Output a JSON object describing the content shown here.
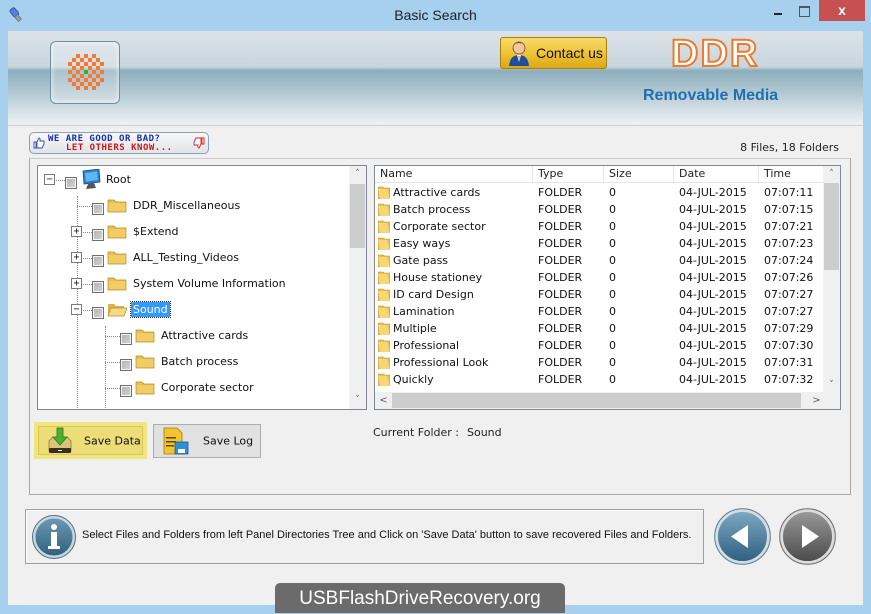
{
  "window": {
    "title": "Basic Search",
    "close_glyph": "x",
    "app_icon": "usb-drive-icon"
  },
  "banner": {
    "contact_label": "Contact us",
    "brand": "DDR",
    "subtitle": "Removable Media",
    "brand_color": "#f07a2a",
    "subtitle_color": "#1f6fb2"
  },
  "feedback": {
    "line1": "WE ARE GOOD OR BAD?",
    "line2": "LET OTHERS KNOW..."
  },
  "summary": {
    "counts": "8 Files, 18 Folders"
  },
  "tree": {
    "nodes": [
      {
        "label": "Root",
        "icon": "computer-icon",
        "expander": "−",
        "level": 0
      },
      {
        "label": "DDR_Miscellaneous",
        "icon": "folder-icon",
        "expander": "",
        "level": 1
      },
      {
        "label": "$Extend",
        "icon": "folder-icon",
        "expander": "+",
        "level": 1
      },
      {
        "label": "ALL_Testing_Videos",
        "icon": "folder-icon",
        "expander": "+",
        "level": 1
      },
      {
        "label": "System Volume Information",
        "icon": "folder-icon",
        "expander": "+",
        "level": 1
      },
      {
        "label": "Sound",
        "icon": "open-folder-icon",
        "expander": "−",
        "level": 1,
        "selected": true
      },
      {
        "label": "Attractive cards",
        "icon": "folder-icon",
        "expander": "",
        "level": 2
      },
      {
        "label": "Batch process",
        "icon": "folder-icon",
        "expander": "",
        "level": 2
      },
      {
        "label": "Corporate sector",
        "icon": "folder-icon",
        "expander": "",
        "level": 2
      }
    ]
  },
  "list": {
    "columns": [
      "Name",
      "Type",
      "Size",
      "Date",
      "Time"
    ],
    "rows": [
      [
        "Attractive cards",
        "FOLDER",
        "0",
        "04-JUL-2015",
        "07:07:11"
      ],
      [
        "Batch process",
        "FOLDER",
        "0",
        "04-JUL-2015",
        "07:07:15"
      ],
      [
        "Corporate sector",
        "FOLDER",
        "0",
        "04-JUL-2015",
        "07:07:21"
      ],
      [
        "Easy ways",
        "FOLDER",
        "0",
        "04-JUL-2015",
        "07:07:23"
      ],
      [
        "Gate pass",
        "FOLDER",
        "0",
        "04-JUL-2015",
        "07:07:24"
      ],
      [
        "House stationey",
        "FOLDER",
        "0",
        "04-JUL-2015",
        "07:07:26"
      ],
      [
        "ID card Design",
        "FOLDER",
        "0",
        "04-JUL-2015",
        "07:07:27"
      ],
      [
        "Lamination",
        "FOLDER",
        "0",
        "04-JUL-2015",
        "07:07:27"
      ],
      [
        "Multiple",
        "FOLDER",
        "0",
        "04-JUL-2015",
        "07:07:29"
      ],
      [
        "Professional",
        "FOLDER",
        "0",
        "04-JUL-2015",
        "07:07:30"
      ],
      [
        "Professional Look",
        "FOLDER",
        "0",
        "04-JUL-2015",
        "07:07:31"
      ],
      [
        "Quickly",
        "FOLDER",
        "0",
        "04-JUL-2015",
        "07:07:32"
      ]
    ]
  },
  "actions": {
    "save_data": "Save Data",
    "save_log": "Save Log"
  },
  "current_folder": {
    "label": "Current Folder :",
    "value": "Sound"
  },
  "status": {
    "message": "Select Files and Folders from left Panel Directories Tree and Click on 'Save Data' button to save recovered Files and Folders."
  },
  "watermark": "USBFlashDriveRecovery.org",
  "scroll": {
    "up": "˄",
    "down": "˅",
    "left": "<",
    "right": ">"
  }
}
